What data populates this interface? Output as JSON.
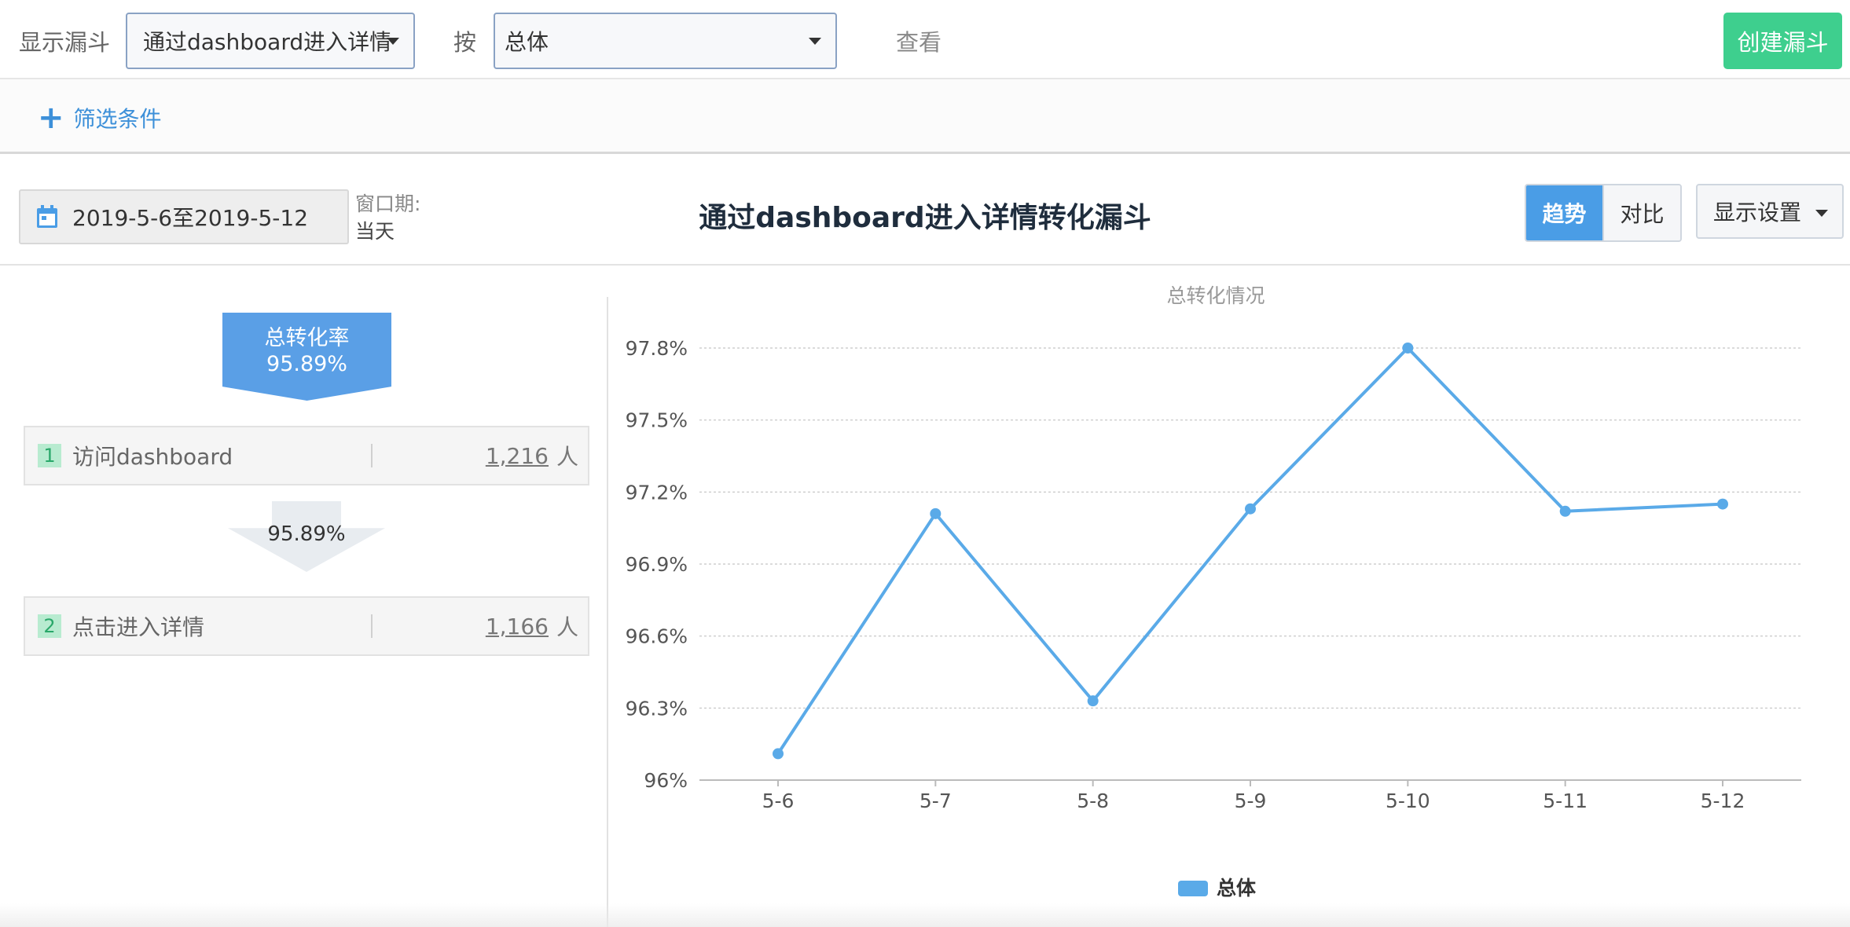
{
  "topbar": {
    "show_funnel_label": "显示漏斗",
    "funnel_select": "通过dashboard进入详情",
    "by_label": "按",
    "group_select": "总体",
    "view_label": "查看",
    "create_button": "创建漏斗"
  },
  "filter": {
    "add_label": "筛选条件"
  },
  "toolbar": {
    "date_range": "2019-5-6至2019-5-12",
    "window_label": "窗口期:",
    "window_value": "当天",
    "title": "通过dashboard进入详情转化漏斗",
    "trend_label": "趋势",
    "compare_label": "对比",
    "display_settings": "显示设置"
  },
  "funnel": {
    "total_rate_label": "总转化率",
    "total_rate": "95.89%",
    "steps": [
      {
        "num": "1",
        "name": "访问dashboard",
        "count": "1,216",
        "unit": "人"
      },
      {
        "num": "2",
        "name": "点击进入详情",
        "count": "1,166",
        "unit": "人"
      }
    ],
    "step_rate": "95.89%"
  },
  "colors": {
    "accent": "#4a9de6",
    "create": "#3ecf8e",
    "line": "#5aaae8"
  },
  "chart_data": {
    "type": "line",
    "title": "总转化情况",
    "categories": [
      "5-6",
      "5-7",
      "5-8",
      "5-9",
      "5-10",
      "5-11",
      "5-12"
    ],
    "series": [
      {
        "name": "总体",
        "values": [
          96.11,
          97.11,
          96.33,
          97.13,
          97.8,
          97.12,
          97.15
        ]
      }
    ],
    "yticks": [
      "96%",
      "96.3%",
      "96.6%",
      "96.9%",
      "97.2%",
      "97.5%",
      "97.8%"
    ],
    "ylim": [
      96,
      97.8
    ],
    "grid": true,
    "legend": "bottom-center"
  }
}
